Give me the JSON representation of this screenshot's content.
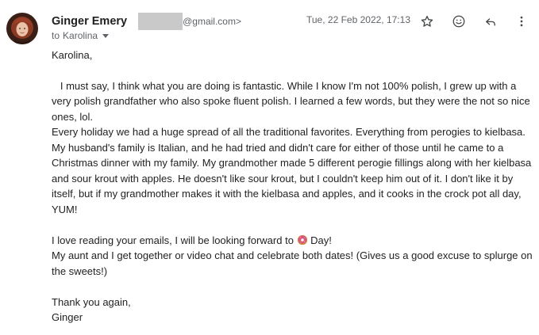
{
  "header": {
    "sender_name": "Ginger Emery",
    "sender_email_suffix": "@gmail.com>",
    "recipient_prefix": "to",
    "recipient": "Karolina",
    "date": "Tue, 22 Feb 2022, 17:13"
  },
  "icons": {
    "star": "star-icon",
    "emoji": "smiley-icon",
    "reply": "reply-icon",
    "more": "more-vert-icon",
    "donut": "doughnut-emoji"
  },
  "body": {
    "greeting": "Karolina,",
    "paragraph1": "   I must say, I think what you are doing is fantastic. While I know I'm not 100% polish, I grew up with a very polish grandfather who also spoke fluent polish. I learned a few words, but they were the not so nice ones, lol.",
    "paragraph2": "Every holiday we had a huge spread of all the traditional favorites. Everything from perogies to kielbasa. My husband's family is Italian, and he had tried and didn't care for either of those until he came to a Christmas dinner with my family. My grandmother made 5 different perogie fillings along with her kielbasa and sour krout with apples. He doesn't like sour krout,  but I couldn't keep him out of it. I don't like it by itself, but if my grandmother makes it with the kielbasa and apples, and it cooks in the crock pot all day, YUM!",
    "paragraph3_before": "I love reading your emails, I will be looking forward to ",
    "paragraph3_after": " Day!",
    "paragraph4": "My aunt and I get together or video chat and celebrate both dates! (Gives us a good excuse to splurge on the sweets!)",
    "closing": "Thank you again,",
    "signature": "Ginger"
  }
}
